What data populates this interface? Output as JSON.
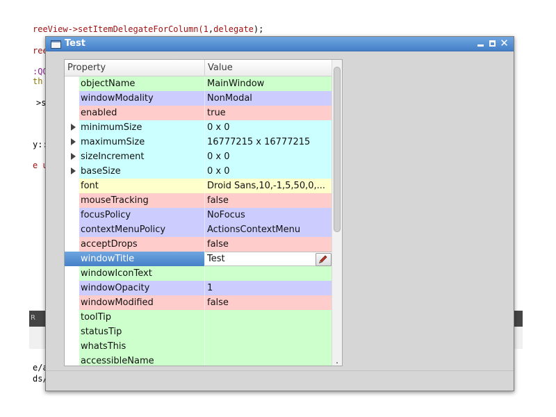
{
  "background_code": {
    "line1_prefix": "reeView->setItemDelegateForColumn(",
    "line1_num": "1",
    "line1_sep": ",",
    "line1_arg": "delegate",
    "line1_end": ");",
    "line2": "ree",
    "line3": ":QO",
    "line4": "th",
    "line5": ">s",
    "line6": "y::",
    "line7": "e u",
    "line8": "e/a",
    "line9": "ds/",
    "strip_label": "R"
  },
  "dialog": {
    "title": "Test",
    "table": {
      "header": {
        "property": "Property",
        "value": "Value"
      },
      "rows": [
        {
          "name": "objectName",
          "value": "MainWindow",
          "color": "green",
          "expandable": false
        },
        {
          "name": "windowModality",
          "value": "NonModal",
          "color": "blue",
          "expandable": false
        },
        {
          "name": "enabled",
          "value": "true",
          "color": "red",
          "expandable": false
        },
        {
          "name": "minimumSize",
          "value": "0 x 0",
          "color": "cyan",
          "expandable": true
        },
        {
          "name": "maximumSize",
          "value": "16777215 x 16777215",
          "color": "cyan",
          "expandable": true
        },
        {
          "name": "sizeIncrement",
          "value": "0 x 0",
          "color": "cyan",
          "expandable": true
        },
        {
          "name": "baseSize",
          "value": "0 x 0",
          "color": "cyan",
          "expandable": true
        },
        {
          "name": "font",
          "value": "Droid Sans,10,-1,5,50,0,...",
          "color": "yellow",
          "expandable": false
        },
        {
          "name": "mouseTracking",
          "value": "false",
          "color": "red",
          "expandable": false
        },
        {
          "name": "focusPolicy",
          "value": "NoFocus",
          "color": "blue",
          "expandable": false
        },
        {
          "name": "contextMenuPolicy",
          "value": "ActionsContextMenu",
          "color": "blue",
          "expandable": false
        },
        {
          "name": "acceptDrops",
          "value": "false",
          "color": "red",
          "expandable": false
        },
        {
          "name": "windowTitle",
          "value": "Test",
          "color": "green",
          "expandable": false,
          "selected": true
        },
        {
          "name": "windowIconText",
          "value": "",
          "color": "green",
          "expandable": false
        },
        {
          "name": "windowOpacity",
          "value": "1",
          "color": "blue",
          "expandable": false
        },
        {
          "name": "windowModified",
          "value": "false",
          "color": "red",
          "expandable": false
        },
        {
          "name": "toolTip",
          "value": "",
          "color": "green",
          "expandable": false
        },
        {
          "name": "statusTip",
          "value": "",
          "color": "green",
          "expandable": false
        },
        {
          "name": "whatsThis",
          "value": "",
          "color": "green",
          "expandable": false
        },
        {
          "name": "accessibleName",
          "value": "",
          "color": "green",
          "expandable": false
        }
      ]
    }
  },
  "colors": {
    "green": "#ccffcc",
    "blue": "#ccccff",
    "red": "#ffcccc",
    "cyan": "#ccffff",
    "yellow": "#ffffcc",
    "selection": "#4a86cc"
  },
  "icons": {
    "window": "window-icon",
    "minimize": "minimize-icon",
    "maximize": "maximize-icon",
    "close": "close-icon",
    "edit": "pencil-icon",
    "expand": "triangle-right-icon"
  }
}
